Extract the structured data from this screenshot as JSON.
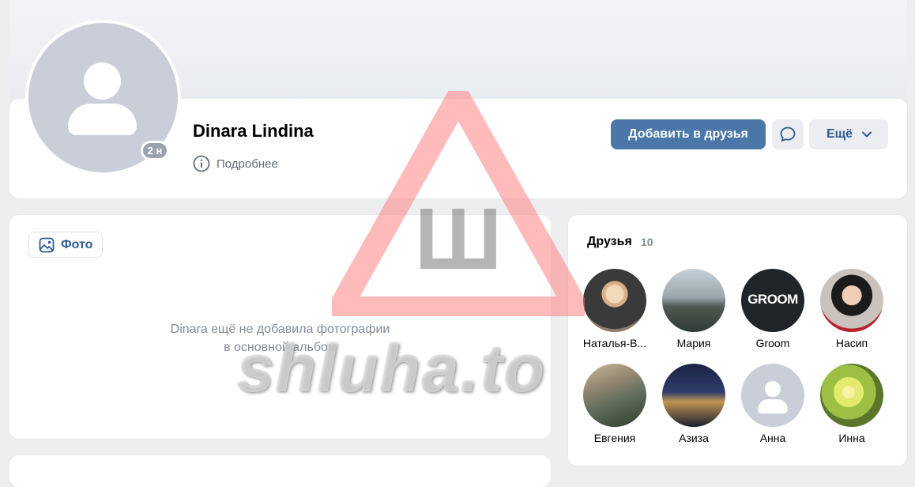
{
  "profile": {
    "name": "Dinara Lindina",
    "online_badge": "2 н",
    "details_label": "Подробнее",
    "add_friend_label": "Добавить в друзья",
    "more_label": "Ещё"
  },
  "photos": {
    "tab_label": "Фото",
    "empty_line1": "Dinara ещё не добавила фотографии",
    "empty_line2": "в основной альбом"
  },
  "friends": {
    "title": "Друзья",
    "count": "10",
    "items": [
      {
        "name": "Наталья-В..."
      },
      {
        "name": "Мария"
      },
      {
        "name": "Groom",
        "avatar_text": "GROOM"
      },
      {
        "name": "Насип"
      },
      {
        "name": "Евгения"
      },
      {
        "name": "Азиза"
      },
      {
        "name": "Анна"
      },
      {
        "name": "Инна"
      }
    ]
  },
  "watermark": {
    "logo_letter": "Ш",
    "text": "shluha.to"
  },
  "colors": {
    "accent": "#4a76a8",
    "link": "#2c5d93",
    "background": "#edeef0",
    "muted": "#818c99"
  }
}
